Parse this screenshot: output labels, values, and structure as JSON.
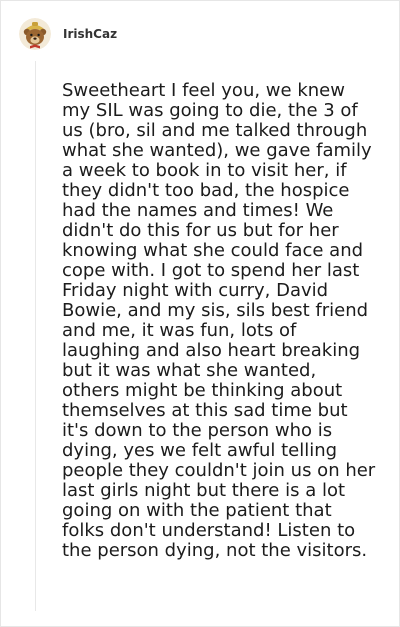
{
  "comment": {
    "username": "IrishCaz",
    "avatar_icon": "cartoon-bear-avatar",
    "body": "Sweetheart I feel you, we knew my SIL was going to die, the 3 of us (bro, sil and me talked through what she wanted), we gave family a week to book in to visit her, if they didn't too bad, the hospice had the names and times! We didn't do this for us but for her knowing what she could face and cope with. I got to spend her last Friday night with curry, David Bowie, and my sis, sils best friend and me, it was fun, lots of laughing and also heart breaking but it was what she wanted, others might be thinking about themselves at this sad time but it's down to the person who is dying, yes we felt awful telling people they couldn't join us on her last girls night but there is a lot going on with the patient that folks don't understand! Listen to the person dying, not the visitors."
  },
  "colors": {
    "border": "#e6e6e6",
    "text": "#1c1c1c",
    "username": "#333333"
  }
}
